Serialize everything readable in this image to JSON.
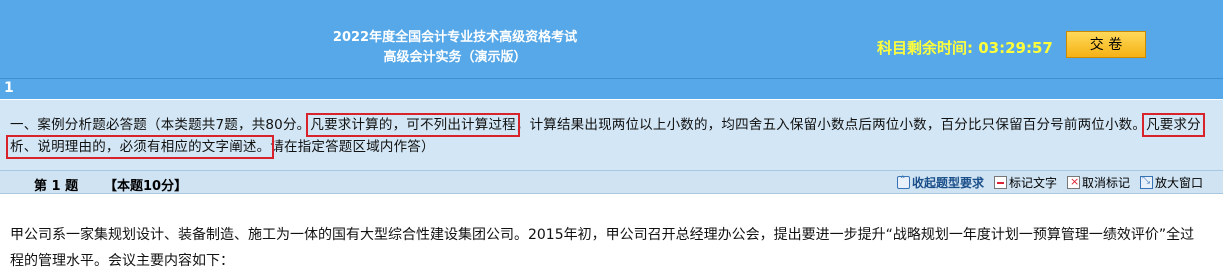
{
  "header": {
    "title_line1": "2022年度全国会计专业技术高级资格考试",
    "title_line2": "高级会计实务（演示版）",
    "timer_label": "科目剩余时间:",
    "timer_value": "03:29:57",
    "submit_label": "交 卷"
  },
  "question_bar": {
    "number": "1"
  },
  "instructions": {
    "part1": "一、案例分析题必答题（本类题共7题，共80分。",
    "highlight1": "凡要求计算的，可不列出计算过程",
    "part2": "，计算结果出现两位以上小数的，均四舍五入保留小数点后两位小数，百分比只保留百分号前两位小数。",
    "highlight2": "凡要求分析、说明理由的，必须有相应的文字阐述。",
    "part3": "请在指定答题区域内作答）"
  },
  "question_header": {
    "label": "第 1 题",
    "score": "【本题10分】",
    "tools": {
      "collapse": "收起题型要求",
      "mark": "标记文字",
      "unmark": "取消标记",
      "zoom": "放大窗口"
    }
  },
  "question_body": {
    "text": "甲公司系一家集规划设计、装备制造、施工为一体的国有大型综合性建设集团公司。2015年初，甲公司召开总经理办公会，提出要进一步提升“战略规划一年度计划一预算管理一绩效评价”全过程的管理水平。会议主要内容如下："
  }
}
